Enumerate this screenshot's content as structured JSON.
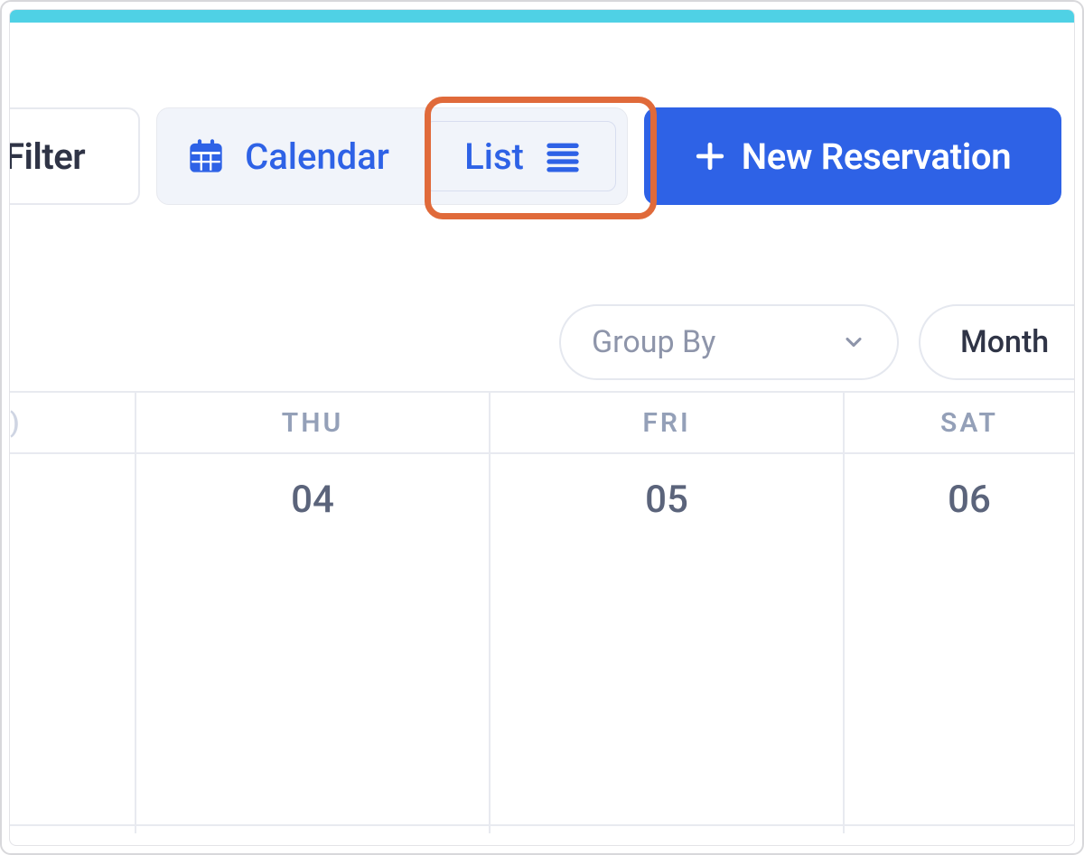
{
  "toolbar": {
    "filter_label": "Filter",
    "calendar_label": "Calendar",
    "list_label": "List",
    "new_reservation_label": "New Reservation"
  },
  "controls": {
    "group_by_label": "Group By",
    "view_label": "Month"
  },
  "calendar": {
    "day_headers_partial_first": ")",
    "day_headers": [
      "THU",
      "FRI",
      "SAT"
    ],
    "dates": [
      "04",
      "05",
      "06"
    ]
  },
  "highlight": {
    "target": "list-view-button"
  }
}
